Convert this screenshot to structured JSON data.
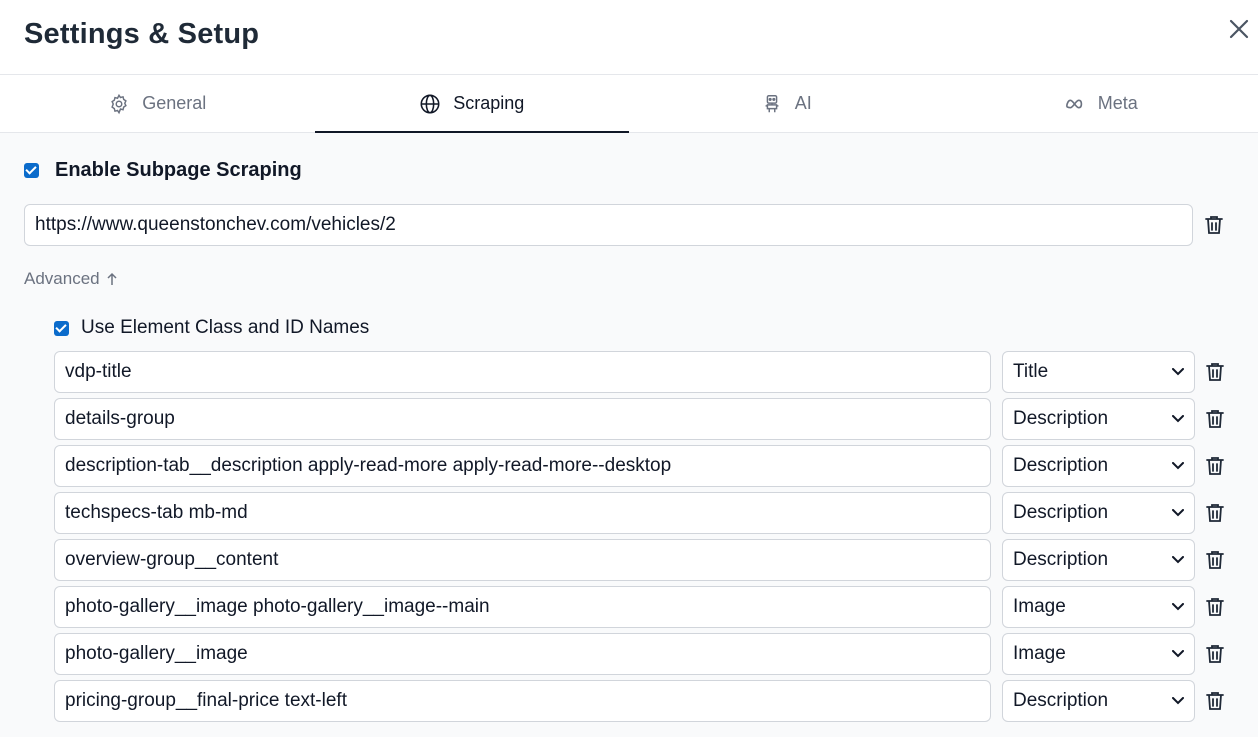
{
  "dialog": {
    "title": "Settings & Setup",
    "close_icon": "close-icon"
  },
  "tabs": [
    {
      "label": "General",
      "icon": "gear-icon",
      "active": false
    },
    {
      "label": "Scraping",
      "icon": "globe-icon",
      "active": true
    },
    {
      "label": "AI",
      "icon": "robot-icon",
      "active": false
    },
    {
      "label": "Meta",
      "icon": "meta-icon",
      "active": false
    }
  ],
  "scraping": {
    "enable_subpage_label": "Enable Subpage Scraping",
    "enable_subpage_checked": true,
    "url_value": "https://www.queenstonchev.com/vehicles/2",
    "advanced_label": "Advanced",
    "advanced_icon": "arrow-up-icon",
    "use_class_id_label": "Use Element Class and ID Names",
    "use_class_id_checked": true,
    "rules": [
      {
        "selector": "vdp-title",
        "type": "Title"
      },
      {
        "selector": "details-group",
        "type": "Description"
      },
      {
        "selector": "description-tab__description apply-read-more apply-read-more--desktop",
        "type": "Description"
      },
      {
        "selector": "techspecs-tab mb-md",
        "type": "Description"
      },
      {
        "selector": "overview-group__content",
        "type": "Description"
      },
      {
        "selector": "photo-gallery__image photo-gallery__image--main",
        "type": "Image"
      },
      {
        "selector": "photo-gallery__image",
        "type": "Image"
      },
      {
        "selector": "pricing-group__final-price text-left",
        "type": "Description"
      }
    ]
  },
  "colors": {
    "accent": "#0b6bcb",
    "text": "#111827",
    "muted": "#6b7280",
    "border": "#d1d5db"
  }
}
